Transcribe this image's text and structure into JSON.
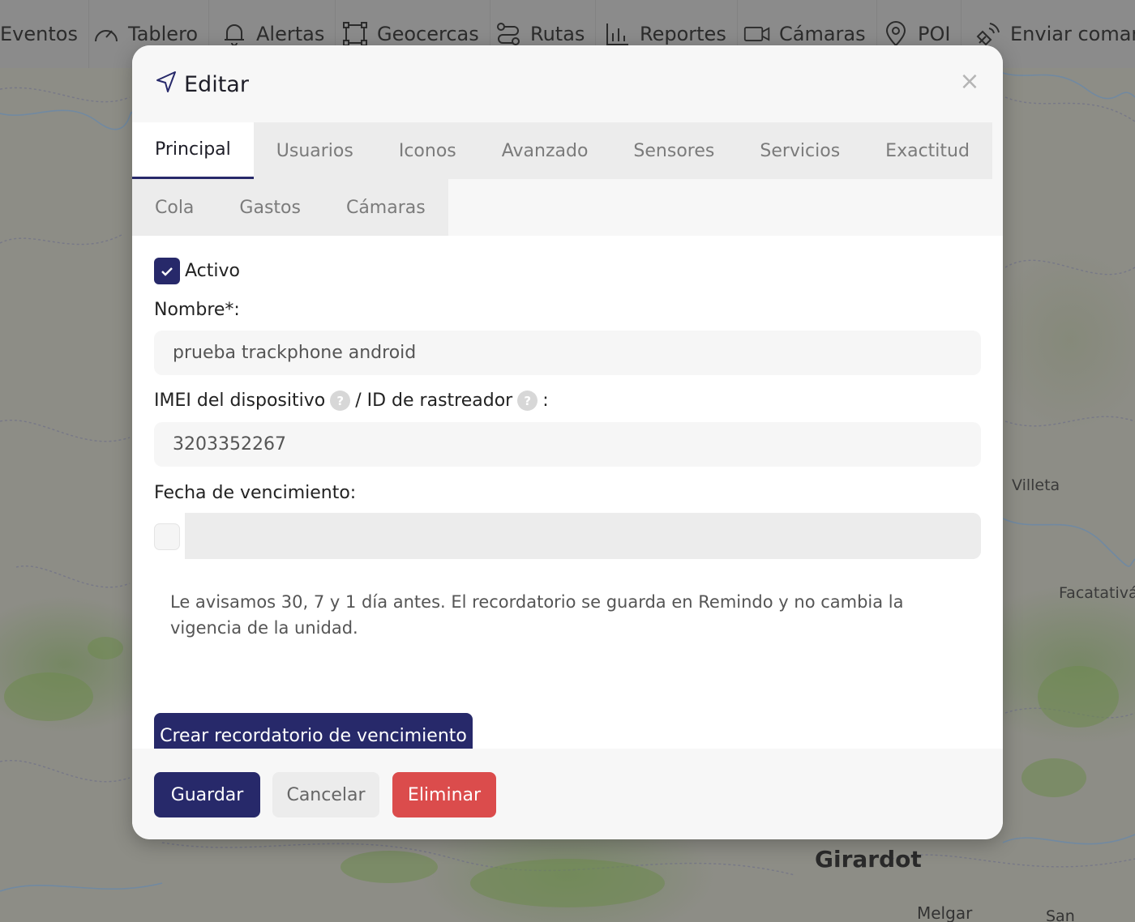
{
  "nav": {
    "items": [
      {
        "label": "Eventos",
        "icon": "none"
      },
      {
        "label": "Tablero",
        "icon": "gauge-icon"
      },
      {
        "label": "Alertas",
        "icon": "bell-icon"
      },
      {
        "label": "Geocercas",
        "icon": "geofence-icon"
      },
      {
        "label": "Rutas",
        "icon": "route-icon"
      },
      {
        "label": "Reportes",
        "icon": "bar-chart-icon"
      },
      {
        "label": "Cámaras",
        "icon": "video-camera-icon"
      },
      {
        "label": "POI",
        "icon": "map-pin-icon"
      },
      {
        "label": "Enviar comand",
        "icon": "satellite-icon"
      }
    ]
  },
  "map": {
    "labels": {
      "villeta": "Villeta",
      "facatativa": "Facatativá",
      "girardot": "Girardot",
      "melgar": "Melgar",
      "san": "San"
    }
  },
  "modal": {
    "title": "Editar",
    "title_icon": "navigation-arrow-icon",
    "close_symbol": "×",
    "tabs_row1": [
      "Principal",
      "Usuarios",
      "Iconos",
      "Avanzado",
      "Sensores",
      "Servicios",
      "Exactitud"
    ],
    "tabs_row2": [
      "Cola",
      "Gastos",
      "Cámaras"
    ],
    "active_tab": "Principal",
    "form": {
      "active_label": "Activo",
      "active_checked": true,
      "name_label": "Nombre*:",
      "name_value": "prueba trackphone android",
      "imei_label": "IMEI del dispositivo",
      "tracker_label": "/ ID de rastreador",
      "imei_suffix": ":",
      "imei_value": "3203352267",
      "expiry_label": "Fecha de vencimiento:",
      "expiry_checked": false,
      "expiry_value": "",
      "note": "Le avisamos 30, 7 y 1 día antes. El recordatorio se guarda en Remindo y no cambia la vigencia de la unidad.",
      "reminder_button": "Crear recordatorio de vencimiento",
      "help_symbol": "?"
    },
    "footer": {
      "save": "Guardar",
      "cancel": "Cancelar",
      "delete": "Eliminar"
    }
  },
  "colors": {
    "primary": "#27296a",
    "danger": "#db4c4c",
    "nav_bg": "#8b8b8b"
  }
}
